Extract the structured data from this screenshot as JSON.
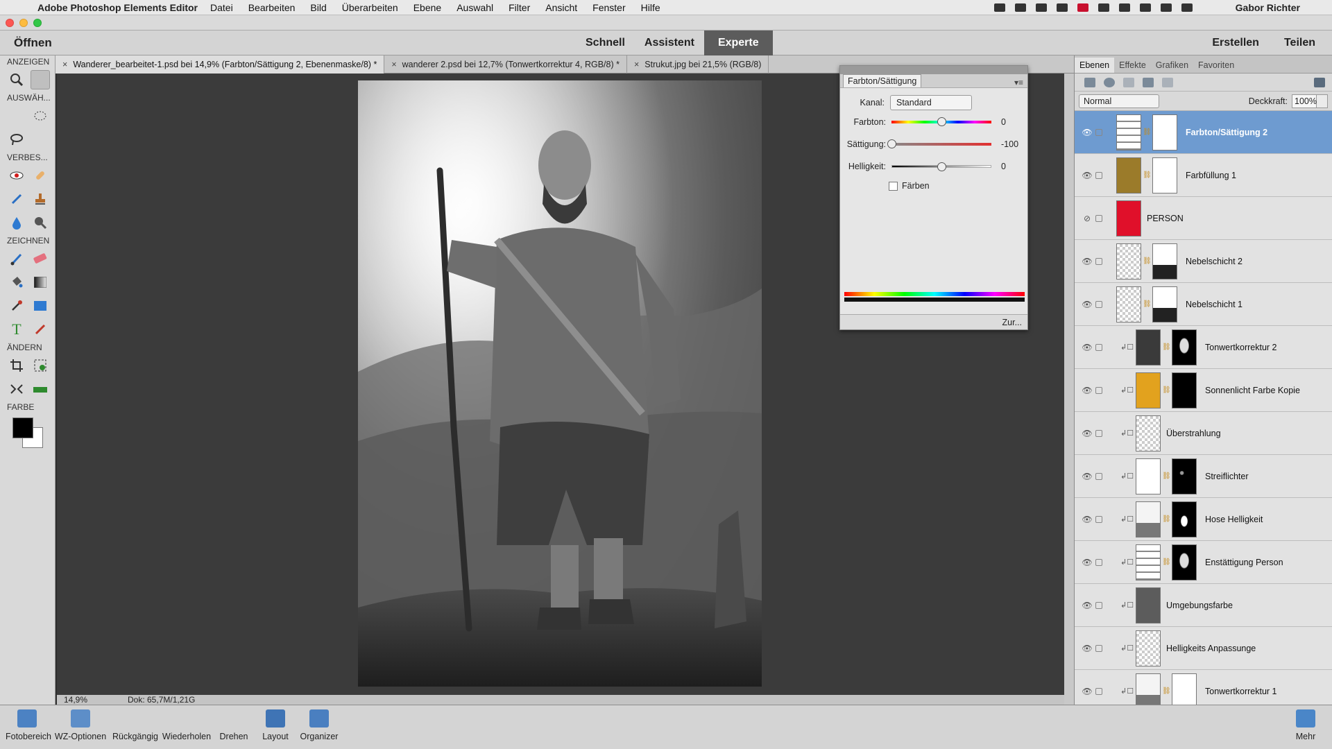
{
  "menubar": {
    "app": "Adobe Photoshop Elements Editor",
    "items": [
      "Datei",
      "Bearbeiten",
      "Bild",
      "Überarbeiten",
      "Ebene",
      "Auswahl",
      "Filter",
      "Ansicht",
      "Fenster",
      "Hilfe"
    ],
    "user": "Gabor Richter"
  },
  "modebar": {
    "open": "Öffnen",
    "modes": [
      "Schnell",
      "Assistent",
      "Experte"
    ],
    "active_mode": "Experte",
    "create": "Erstellen",
    "share": "Teilen"
  },
  "toolbox": {
    "sections": [
      "ANZEIGEN",
      "AUSWÄH...",
      "VERBES...",
      "ZEICHNEN",
      "ÄNDERN",
      "FARBE"
    ],
    "foreground": "#000000",
    "background": "#ffffff"
  },
  "tabs": [
    "Wanderer_bearbeitet-1.psd bei 14,9% (Farbton/Sättigung 2, Ebenenmaske/8) *",
    "wanderer 2.psd bei 12,7% (Tonwertkorrektur 4, RGB/8) *",
    "Strukut.jpg bei 21,5% (RGB/8)"
  ],
  "status": {
    "zoom": "14,9%",
    "doc": "Dok: 65,7M/1,21G"
  },
  "huesat": {
    "tab": "Farbton/Sättigung",
    "channel_label": "Kanal:",
    "channel_value": "Standard",
    "sliders": [
      {
        "label": "Farbton:",
        "value": "0",
        "pos": 0.5
      },
      {
        "label": "Sättigung:",
        "value": "-100",
        "pos": 0.0
      },
      {
        "label": "Helligkeit:",
        "value": "0",
        "pos": 0.5
      }
    ],
    "colorize": "Färben",
    "reset": "Zur..."
  },
  "layers_panel": {
    "tabs": [
      "Ebenen",
      "Effekte",
      "Grafiken",
      "Favoriten"
    ],
    "blend_mode": "Normal",
    "opacity_label": "Deckkraft:",
    "opacity": "100%",
    "layers": [
      {
        "name": "Farbton/Sättigung 2",
        "selected": true,
        "visible": true,
        "clipped": false,
        "thumb": "adjust",
        "mask": "white"
      },
      {
        "name": "Farbfüllung 1",
        "selected": false,
        "visible": true,
        "clipped": false,
        "thumb": "#9b7b2a",
        "mask": "white"
      },
      {
        "name": "PERSON",
        "selected": false,
        "visible": false,
        "clipped": false,
        "thumb": "#e0102a",
        "mask": ""
      },
      {
        "name": "Nebelschicht 2",
        "selected": false,
        "visible": true,
        "clipped": false,
        "thumb": "checker",
        "mask": "fog"
      },
      {
        "name": "Nebelschicht 1",
        "selected": false,
        "visible": true,
        "clipped": false,
        "thumb": "checker",
        "mask": "fog"
      },
      {
        "name": "Tonwertkorrektur 2",
        "selected": false,
        "visible": true,
        "clipped": true,
        "thumb": "dark",
        "mask": "figure"
      },
      {
        "name": "Sonnenlicht Farbe Kopie",
        "selected": false,
        "visible": true,
        "clipped": true,
        "thumb": "#e2a21e",
        "mask": "black"
      },
      {
        "name": "Überstrahlung",
        "selected": false,
        "visible": true,
        "clipped": true,
        "thumb": "checker",
        "mask": ""
      },
      {
        "name": "Streiflichter",
        "selected": false,
        "visible": true,
        "clipped": true,
        "thumb": "white",
        "mask": "specks"
      },
      {
        "name": "Hose Helligkeit",
        "selected": false,
        "visible": true,
        "clipped": true,
        "thumb": "histogram",
        "mask": "blob"
      },
      {
        "name": "Enstättigung Person",
        "selected": false,
        "visible": true,
        "clipped": true,
        "thumb": "adjust",
        "mask": "figure"
      },
      {
        "name": "Umgebungsfarbe",
        "selected": false,
        "visible": true,
        "clipped": true,
        "thumb": "#5c5c5c",
        "mask": ""
      },
      {
        "name": "Helligkeits Anpassunge",
        "selected": false,
        "visible": true,
        "clipped": true,
        "thumb": "checker",
        "mask": ""
      },
      {
        "name": "Tonwertkorrektur 1",
        "selected": false,
        "visible": true,
        "clipped": true,
        "thumb": "histogram",
        "mask": "white"
      }
    ]
  },
  "bottombar": {
    "buttons": [
      "Fotobereich",
      "WZ-Optionen",
      "Rückgängig",
      "Wiederholen",
      "Drehen",
      "Layout",
      "Organizer"
    ],
    "more": "Mehr"
  }
}
